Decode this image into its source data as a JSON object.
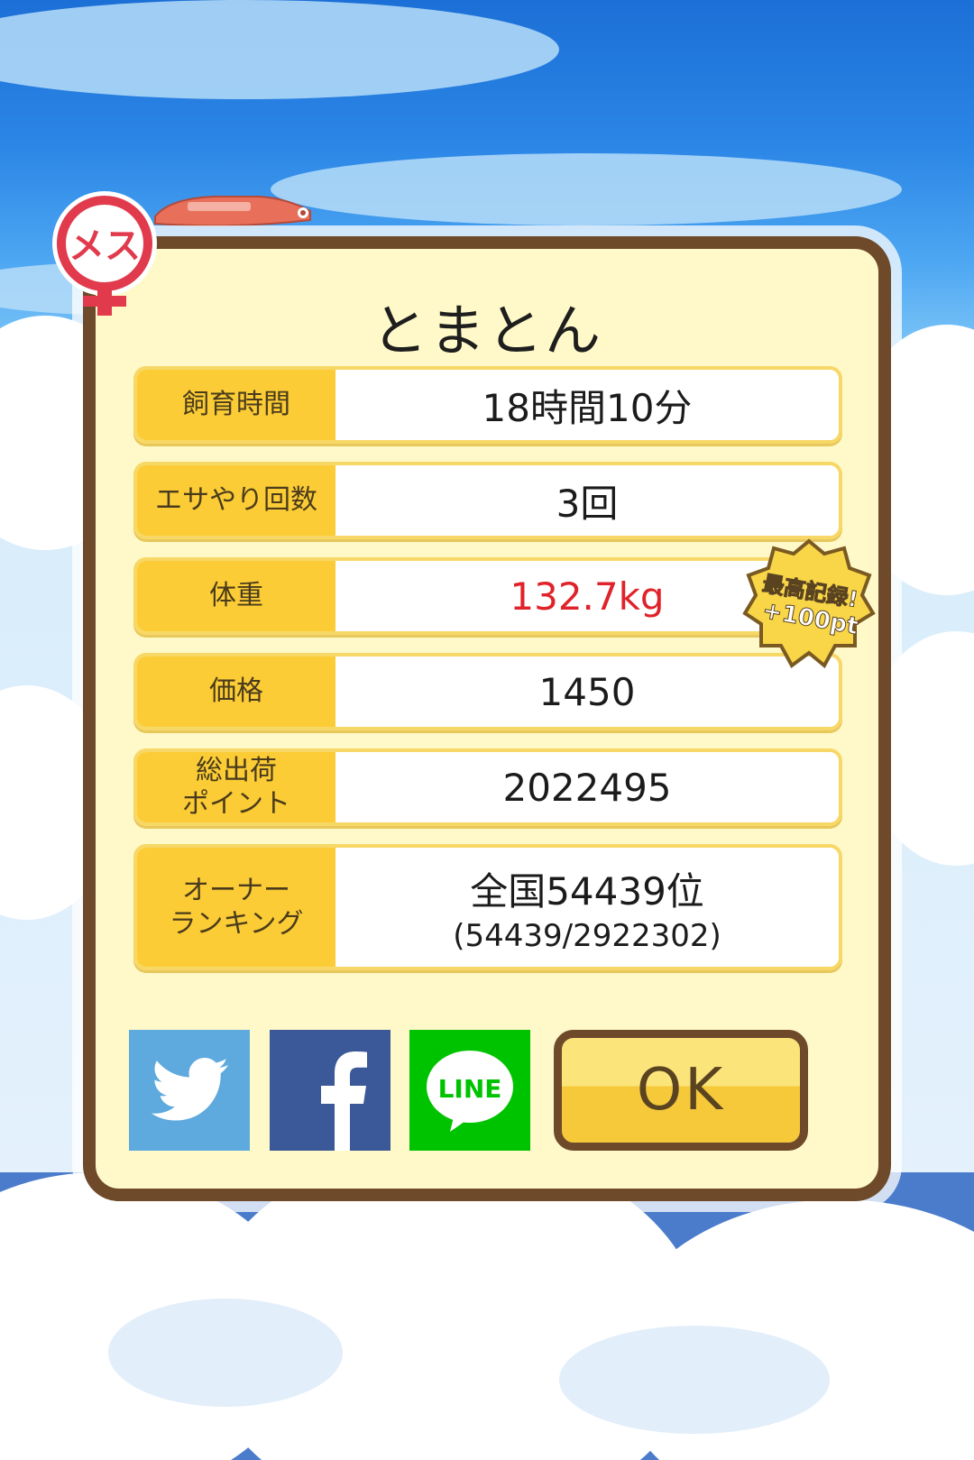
{
  "pet": {
    "name": "とまとん",
    "gender_label": "メス"
  },
  "stats": [
    {
      "label": "飼育時間",
      "value": "18時間10分"
    },
    {
      "label": "エサやり回数",
      "value": "3回"
    },
    {
      "label": "体重",
      "value": "132.7kg",
      "highlight": "red"
    },
    {
      "label": "価格",
      "value": "1450"
    },
    {
      "label": "総出荷\nポイント",
      "value": "2022495"
    },
    {
      "label": "オーナー\nランキング",
      "value": "全国54439位",
      "sub": "(54439/2922302)"
    }
  ],
  "record_badge": {
    "line1": "最高記録!",
    "line2": "+100pt"
  },
  "buttons": {
    "ok": "OK",
    "line": "LINE"
  },
  "colors": {
    "panel_bg": "#fff9c9",
    "panel_border": "#6e4a2a",
    "label_bg": "#fbcc35",
    "highlight_red": "#e0222a",
    "twitter": "#5ea9dd",
    "facebook": "#3b5998",
    "line": "#00c300"
  },
  "icons": [
    "female-icon",
    "boat-icon",
    "twitter-icon",
    "facebook-icon",
    "line-icon",
    "record-badge-icon"
  ]
}
